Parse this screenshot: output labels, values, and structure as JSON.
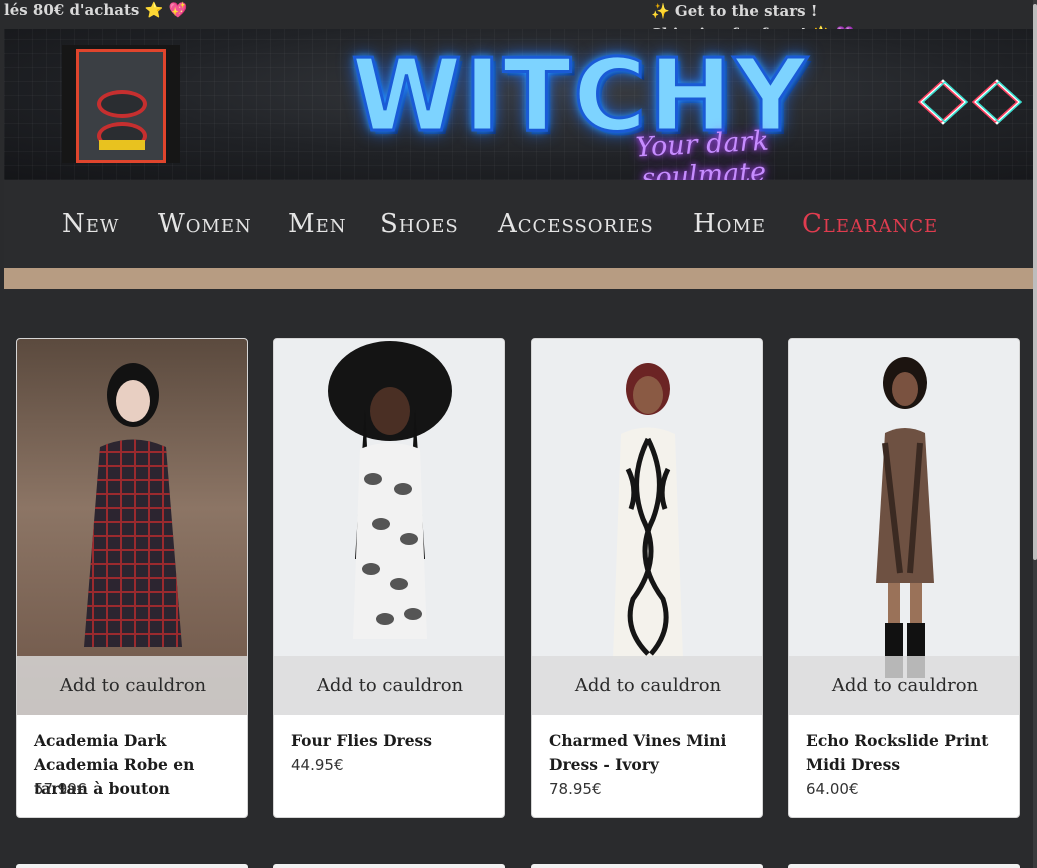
{
  "announcement": {
    "left_text": "lés 80€ d'achats ⭐ 💖",
    "right_text": "✨ Get to the stars ! Shipping for free ! 🌟 💜"
  },
  "banner": {
    "brand": "WITCHY",
    "tagline": "Your dark soulmate"
  },
  "nav": {
    "items": [
      "New",
      "Women",
      "Men",
      "Shoes",
      "Accessories",
      "Home",
      "Clearance"
    ],
    "accent_color": "#e03c4f"
  },
  "products": [
    {
      "name": "Academia Dark Academia Robe en tartan à bouton",
      "price": "57.99€",
      "cta": "Add to cauldron"
    },
    {
      "name": "Four Flies Dress",
      "price": "44.95€",
      "cta": "Add to cauldron"
    },
    {
      "name": "Charmed Vines Mini Dress - Ivory",
      "price": "78.95€",
      "cta": "Add to cauldron"
    },
    {
      "name": "Echo Rockslide Print Midi Dress",
      "price": "64.00€",
      "cta": "Add to cauldron"
    }
  ],
  "colors": {
    "background": "#2a2b2d",
    "tan_bar": "#b79c82",
    "brand_glow": "#2aa8ff",
    "tagline_glow": "#c68cff"
  }
}
